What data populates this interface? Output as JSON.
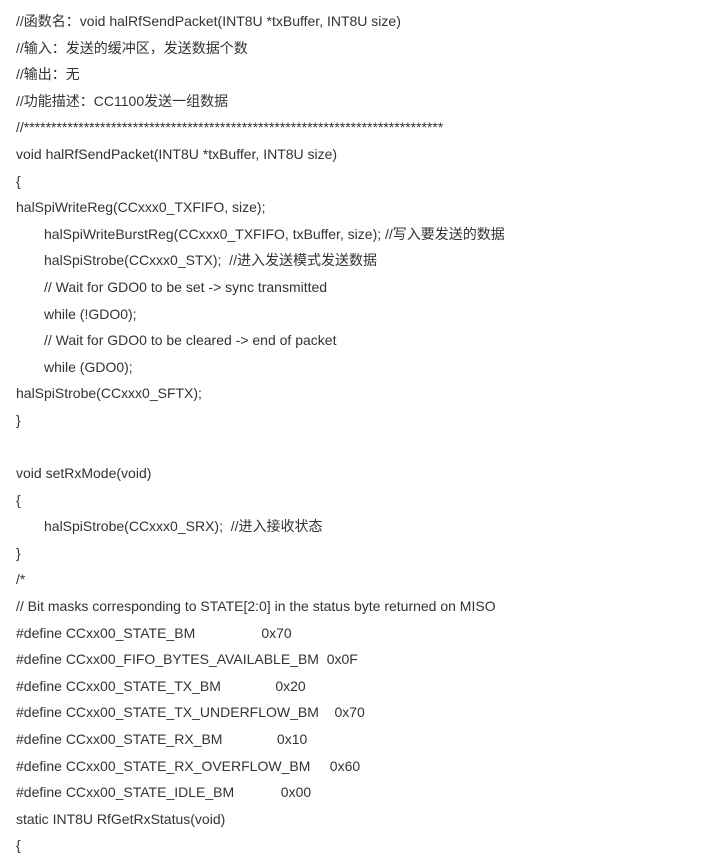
{
  "lines": {
    "l1": "//函数名：void halRfSendPacket(INT8U *txBuffer, INT8U size)",
    "l2": "//输入：发送的缓冲区，发送数据个数",
    "l3": "//输出：无",
    "l4": "//功能描述：CC1100发送一组数据",
    "l5": "//*****************************************************************************",
    "l6": "void halRfSendPacket(INT8U *txBuffer, INT8U size)",
    "l7": "{",
    "l8": "halSpiWriteReg(CCxxx0_TXFIFO, size);",
    "l9": "halSpiWriteBurstReg(CCxxx0_TXFIFO, txBuffer, size); //写入要发送的数据",
    "l10": "halSpiStrobe(CCxxx0_STX);  //进入发送模式发送数据",
    "l11": "// Wait for GDO0 to be set -> sync transmitted",
    "l12": "while (!GDO0);",
    "l13": "// Wait for GDO0 to be cleared -> end of packet",
    "l14": "while (GDO0);",
    "l15": "halSpiStrobe(CCxxx0_SFTX);",
    "l16": "}",
    "l17": "void setRxMode(void)",
    "l18": "{",
    "l19": "halSpiStrobe(CCxxx0_SRX);  //进入接收状态",
    "l20": "}",
    "l21": "/*",
    "l22": "// Bit masks corresponding to STATE[2:0] in the status byte returned on MISO",
    "l23": "#define CCxx00_STATE_BM                 0x70",
    "l24": "#define CCxx00_FIFO_BYTES_AVAILABLE_BM  0x0F",
    "l25": "#define CCxx00_STATE_TX_BM              0x20",
    "l26": "#define CCxx00_STATE_TX_UNDERFLOW_BM    0x70",
    "l27": "#define CCxx00_STATE_RX_BM              0x10",
    "l28": "#define CCxx00_STATE_RX_OVERFLOW_BM     0x60",
    "l29": "#define CCxx00_STATE_IDLE_BM            0x00",
    "l30": "static INT8U RfGetRxStatus(void)",
    "l31": "{"
  }
}
